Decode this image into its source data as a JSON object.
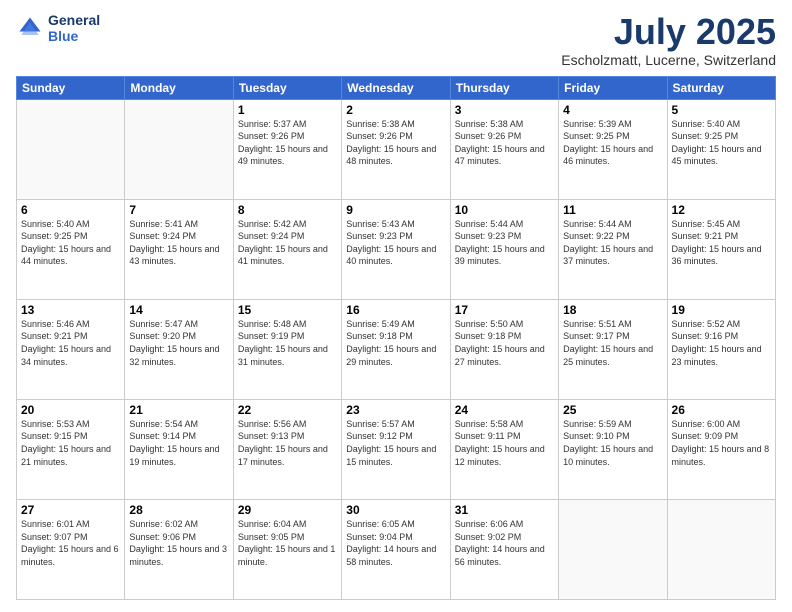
{
  "header": {
    "logo_line1": "General",
    "logo_line2": "Blue",
    "month": "July 2025",
    "location": "Escholzmatt, Lucerne, Switzerland"
  },
  "days_of_week": [
    "Sunday",
    "Monday",
    "Tuesday",
    "Wednesday",
    "Thursday",
    "Friday",
    "Saturday"
  ],
  "weeks": [
    [
      {
        "day": "",
        "sunrise": "",
        "sunset": "",
        "daylight": ""
      },
      {
        "day": "",
        "sunrise": "",
        "sunset": "",
        "daylight": ""
      },
      {
        "day": "1",
        "sunrise": "Sunrise: 5:37 AM",
        "sunset": "Sunset: 9:26 PM",
        "daylight": "Daylight: 15 hours and 49 minutes."
      },
      {
        "day": "2",
        "sunrise": "Sunrise: 5:38 AM",
        "sunset": "Sunset: 9:26 PM",
        "daylight": "Daylight: 15 hours and 48 minutes."
      },
      {
        "day": "3",
        "sunrise": "Sunrise: 5:38 AM",
        "sunset": "Sunset: 9:26 PM",
        "daylight": "Daylight: 15 hours and 47 minutes."
      },
      {
        "day": "4",
        "sunrise": "Sunrise: 5:39 AM",
        "sunset": "Sunset: 9:25 PM",
        "daylight": "Daylight: 15 hours and 46 minutes."
      },
      {
        "day": "5",
        "sunrise": "Sunrise: 5:40 AM",
        "sunset": "Sunset: 9:25 PM",
        "daylight": "Daylight: 15 hours and 45 minutes."
      }
    ],
    [
      {
        "day": "6",
        "sunrise": "Sunrise: 5:40 AM",
        "sunset": "Sunset: 9:25 PM",
        "daylight": "Daylight: 15 hours and 44 minutes."
      },
      {
        "day": "7",
        "sunrise": "Sunrise: 5:41 AM",
        "sunset": "Sunset: 9:24 PM",
        "daylight": "Daylight: 15 hours and 43 minutes."
      },
      {
        "day": "8",
        "sunrise": "Sunrise: 5:42 AM",
        "sunset": "Sunset: 9:24 PM",
        "daylight": "Daylight: 15 hours and 41 minutes."
      },
      {
        "day": "9",
        "sunrise": "Sunrise: 5:43 AM",
        "sunset": "Sunset: 9:23 PM",
        "daylight": "Daylight: 15 hours and 40 minutes."
      },
      {
        "day": "10",
        "sunrise": "Sunrise: 5:44 AM",
        "sunset": "Sunset: 9:23 PM",
        "daylight": "Daylight: 15 hours and 39 minutes."
      },
      {
        "day": "11",
        "sunrise": "Sunrise: 5:44 AM",
        "sunset": "Sunset: 9:22 PM",
        "daylight": "Daylight: 15 hours and 37 minutes."
      },
      {
        "day": "12",
        "sunrise": "Sunrise: 5:45 AM",
        "sunset": "Sunset: 9:21 PM",
        "daylight": "Daylight: 15 hours and 36 minutes."
      }
    ],
    [
      {
        "day": "13",
        "sunrise": "Sunrise: 5:46 AM",
        "sunset": "Sunset: 9:21 PM",
        "daylight": "Daylight: 15 hours and 34 minutes."
      },
      {
        "day": "14",
        "sunrise": "Sunrise: 5:47 AM",
        "sunset": "Sunset: 9:20 PM",
        "daylight": "Daylight: 15 hours and 32 minutes."
      },
      {
        "day": "15",
        "sunrise": "Sunrise: 5:48 AM",
        "sunset": "Sunset: 9:19 PM",
        "daylight": "Daylight: 15 hours and 31 minutes."
      },
      {
        "day": "16",
        "sunrise": "Sunrise: 5:49 AM",
        "sunset": "Sunset: 9:18 PM",
        "daylight": "Daylight: 15 hours and 29 minutes."
      },
      {
        "day": "17",
        "sunrise": "Sunrise: 5:50 AM",
        "sunset": "Sunset: 9:18 PM",
        "daylight": "Daylight: 15 hours and 27 minutes."
      },
      {
        "day": "18",
        "sunrise": "Sunrise: 5:51 AM",
        "sunset": "Sunset: 9:17 PM",
        "daylight": "Daylight: 15 hours and 25 minutes."
      },
      {
        "day": "19",
        "sunrise": "Sunrise: 5:52 AM",
        "sunset": "Sunset: 9:16 PM",
        "daylight": "Daylight: 15 hours and 23 minutes."
      }
    ],
    [
      {
        "day": "20",
        "sunrise": "Sunrise: 5:53 AM",
        "sunset": "Sunset: 9:15 PM",
        "daylight": "Daylight: 15 hours and 21 minutes."
      },
      {
        "day": "21",
        "sunrise": "Sunrise: 5:54 AM",
        "sunset": "Sunset: 9:14 PM",
        "daylight": "Daylight: 15 hours and 19 minutes."
      },
      {
        "day": "22",
        "sunrise": "Sunrise: 5:56 AM",
        "sunset": "Sunset: 9:13 PM",
        "daylight": "Daylight: 15 hours and 17 minutes."
      },
      {
        "day": "23",
        "sunrise": "Sunrise: 5:57 AM",
        "sunset": "Sunset: 9:12 PM",
        "daylight": "Daylight: 15 hours and 15 minutes."
      },
      {
        "day": "24",
        "sunrise": "Sunrise: 5:58 AM",
        "sunset": "Sunset: 9:11 PM",
        "daylight": "Daylight: 15 hours and 12 minutes."
      },
      {
        "day": "25",
        "sunrise": "Sunrise: 5:59 AM",
        "sunset": "Sunset: 9:10 PM",
        "daylight": "Daylight: 15 hours and 10 minutes."
      },
      {
        "day": "26",
        "sunrise": "Sunrise: 6:00 AM",
        "sunset": "Sunset: 9:09 PM",
        "daylight": "Daylight: 15 hours and 8 minutes."
      }
    ],
    [
      {
        "day": "27",
        "sunrise": "Sunrise: 6:01 AM",
        "sunset": "Sunset: 9:07 PM",
        "daylight": "Daylight: 15 hours and 6 minutes."
      },
      {
        "day": "28",
        "sunrise": "Sunrise: 6:02 AM",
        "sunset": "Sunset: 9:06 PM",
        "daylight": "Daylight: 15 hours and 3 minutes."
      },
      {
        "day": "29",
        "sunrise": "Sunrise: 6:04 AM",
        "sunset": "Sunset: 9:05 PM",
        "daylight": "Daylight: 15 hours and 1 minute."
      },
      {
        "day": "30",
        "sunrise": "Sunrise: 6:05 AM",
        "sunset": "Sunset: 9:04 PM",
        "daylight": "Daylight: 14 hours and 58 minutes."
      },
      {
        "day": "31",
        "sunrise": "Sunrise: 6:06 AM",
        "sunset": "Sunset: 9:02 PM",
        "daylight": "Daylight: 14 hours and 56 minutes."
      },
      {
        "day": "",
        "sunrise": "",
        "sunset": "",
        "daylight": ""
      },
      {
        "day": "",
        "sunrise": "",
        "sunset": "",
        "daylight": ""
      }
    ]
  ]
}
